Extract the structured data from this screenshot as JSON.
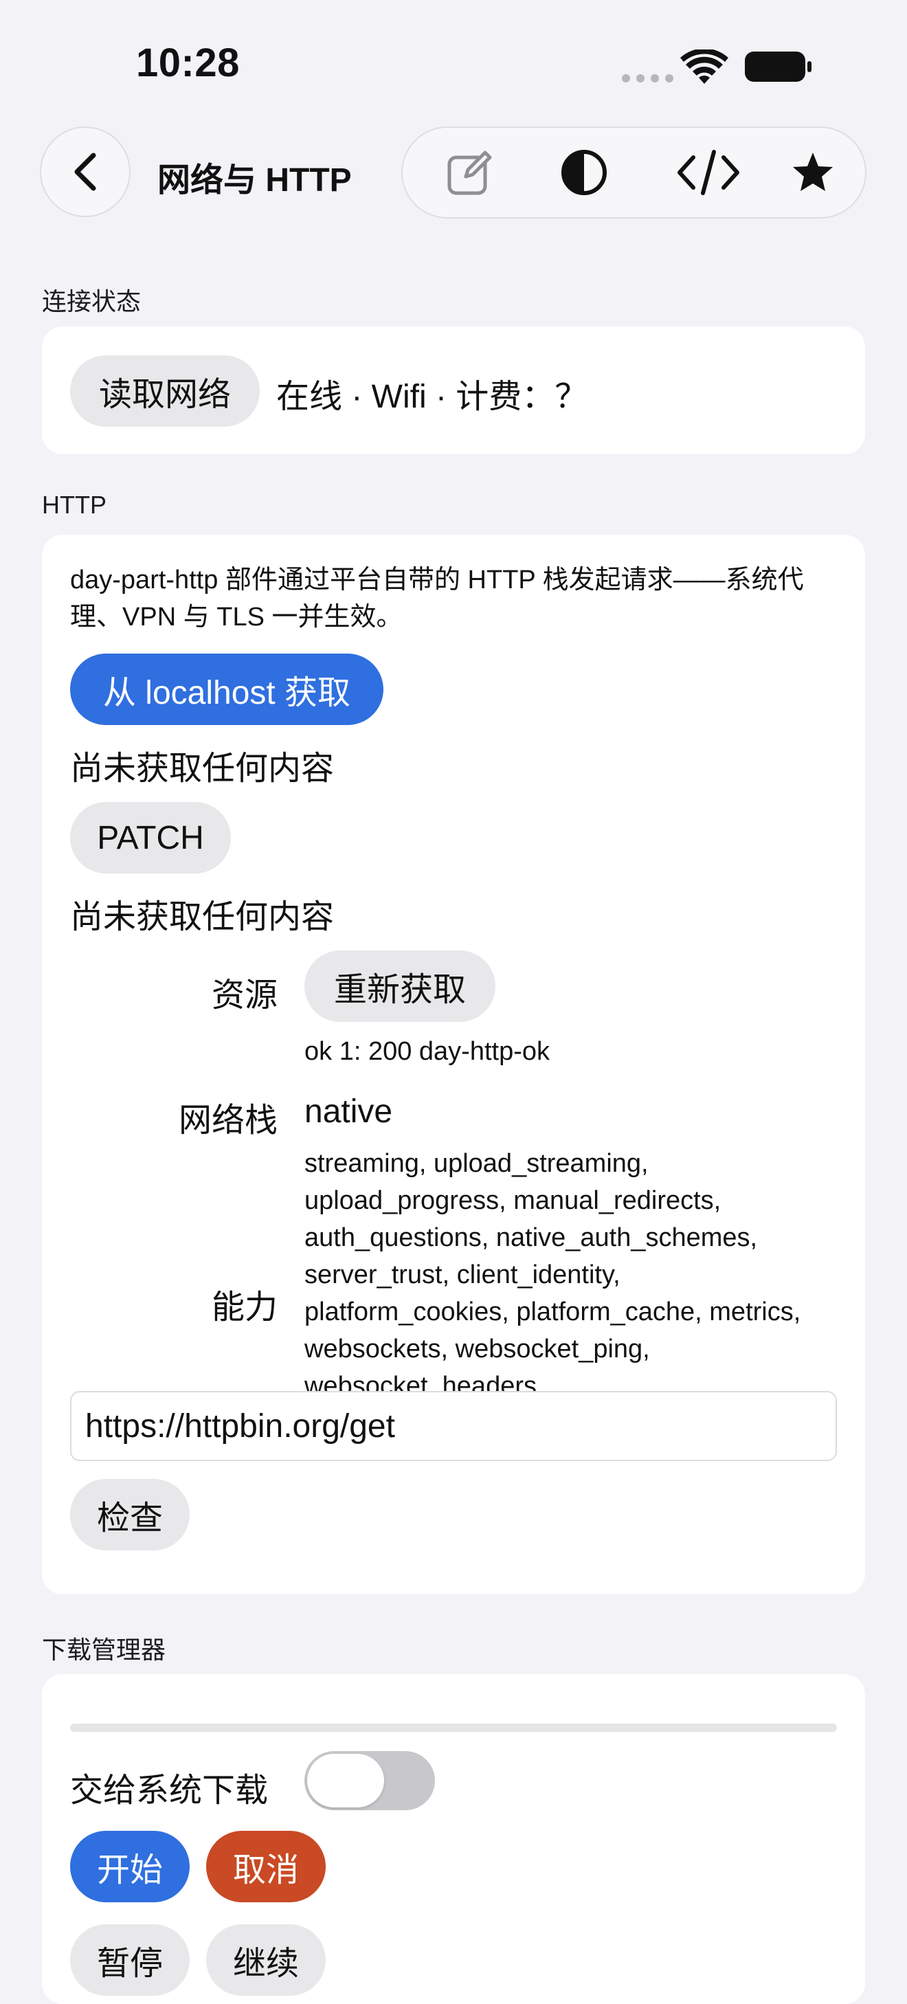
{
  "status_bar": {
    "time": "10:28"
  },
  "nav": {
    "title": "网络与 HTTP",
    "tools": [
      "edit-icon",
      "contrast-icon",
      "code-icon",
      "star-icon"
    ]
  },
  "connection": {
    "header": "连接状态",
    "read_button": "读取网络",
    "status_text": "在线 · Wifi · 计费：？"
  },
  "http": {
    "header": "HTTP",
    "description": "day-part-http 部件通过平台自带的 HTTP 栈发起请求——系统代理、VPN 与 TLS 一并生效。",
    "fetch_localhost_button": "从 localhost 获取",
    "fetch_result": "尚未获取任何内容",
    "patch_button": "PATCH",
    "patch_result": "尚未获取任何内容",
    "resource_label": "资源",
    "refetch_button": "重新获取",
    "resource_result": "ok 1: 200 day-http-ok",
    "stack_label": "网络栈",
    "stack_value": "native",
    "capabilities_label": "能力",
    "capabilities_value": "streaming, upload_streaming, upload_progress, manual_redirects, auth_questions, native_auth_schemes, server_trust, client_identity, platform_cookies, platform_cache, metrics, websockets, websocket_ping, websocket_headers",
    "url_value": "https://httpbin.org/get",
    "inspect_button": "检查"
  },
  "downloads": {
    "header": "下载管理器",
    "progress": 0,
    "handoff_label": "交给系统下载",
    "handoff_on": false,
    "start_button": "开始",
    "cancel_button": "取消",
    "pause_button": "暂停",
    "resume_button": "继续"
  },
  "colors": {
    "accent": "#2f6fdf",
    "danger": "#c94a24",
    "background": "#f2f2f7"
  }
}
